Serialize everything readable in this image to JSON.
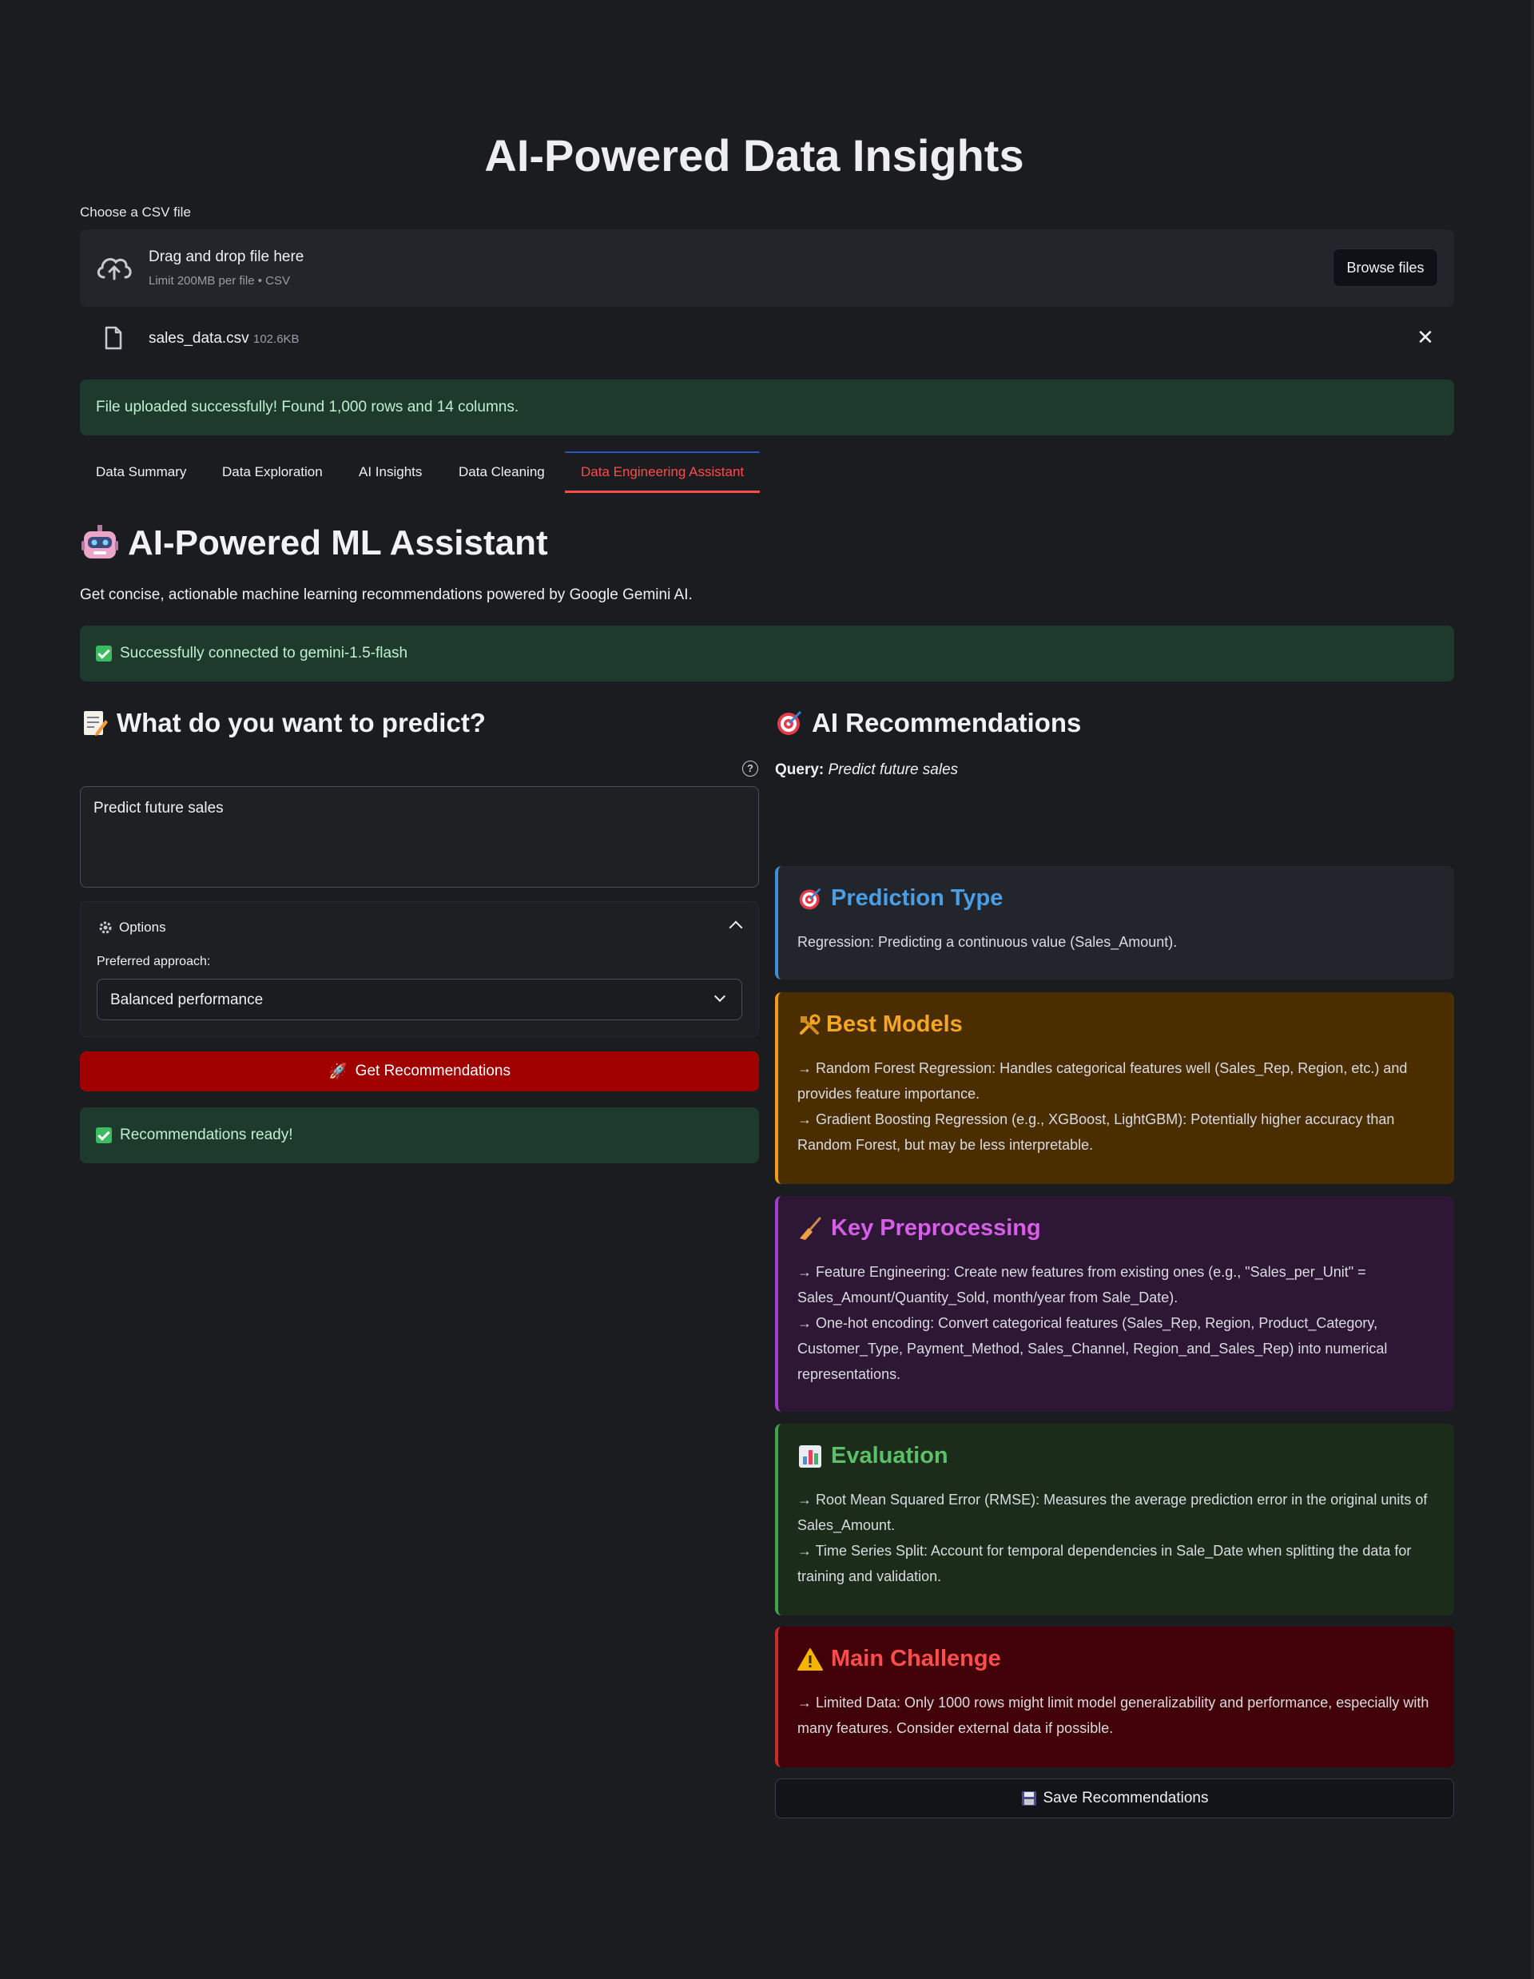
{
  "app": {
    "title": "AI-Powered Data Insights"
  },
  "uploader": {
    "label": "Choose a CSV file",
    "drop_text": "Drag and drop file here",
    "limit_text": "Limit 200MB per file • CSV",
    "browse_label": "Browse files",
    "file_name": "sales_data.csv",
    "file_size": "102.6KB"
  },
  "upload_success": "File uploaded successfully! Found 1,000 rows and 14 columns.",
  "tabs": [
    {
      "label": "Data Summary",
      "active": false
    },
    {
      "label": "Data Exploration",
      "active": false
    },
    {
      "label": "AI Insights",
      "active": false
    },
    {
      "label": "Data Cleaning",
      "active": false
    },
    {
      "label": "Data Engineering Assistant",
      "active": true
    }
  ],
  "assistant": {
    "title": "AI-Powered ML Assistant",
    "description": "Get concise, actionable machine learning recommendations powered by Google Gemini AI.",
    "connected": "Successfully connected to gemini-1.5-flash"
  },
  "predict": {
    "heading": "What do you want to predict?",
    "input_value": "Predict future sales",
    "options_label": "Options",
    "approach_label": "Preferred approach:",
    "approach_value": "Balanced performance",
    "button_label": "Get Recommendations",
    "ready": "Recommendations ready!"
  },
  "recommendations": {
    "heading": "AI Recommendations",
    "query_label": "Query:",
    "query_value": "Predict future sales",
    "prediction_type": {
      "title": "Prediction Type",
      "body": "Regression: Predicting a continuous value (Sales_Amount)."
    },
    "best_models": {
      "title": "Best Models",
      "line1": "→ Random Forest Regression: Handles categorical features well (Sales_Rep, Region, etc.) and provides feature importance.",
      "line2": "→ Gradient Boosting Regression (e.g., XGBoost, LightGBM): Potentially higher accuracy than Random Forest, but may be less interpretable."
    },
    "preprocessing": {
      "title": "Key Preprocessing",
      "line1": "→ Feature Engineering: Create new features from existing ones (e.g., \"Sales_per_Unit\" = Sales_Amount/Quantity_Sold, month/year from Sale_Date).",
      "line2": "→ One-hot encoding: Convert categorical features (Sales_Rep, Region, Product_Category, Customer_Type, Payment_Method, Sales_Channel, Region_and_Sales_Rep) into numerical representations."
    },
    "evaluation": {
      "title": "Evaluation",
      "line1": "→ Root Mean Squared Error (RMSE): Measures the average prediction error in the original units of Sales_Amount.",
      "line2": "→ Time Series Split: Account for temporal dependencies in Sale_Date when splitting the data for training and validation."
    },
    "challenge": {
      "title": "Main Challenge",
      "line1": "→ Limited Data: Only 1000 rows might limit model generalizability and performance, especially with many features. Consider external data if possible."
    },
    "save_label": "Save Recommendations"
  },
  "icons": {
    "upload": "cloud-upload-icon",
    "file": "file-icon",
    "close": "close-icon",
    "check": "check-icon",
    "robot": "robot-icon",
    "memo": "memo-icon",
    "target": "target-icon",
    "tools": "tools-icon",
    "broom": "broom-icon",
    "chart": "bar-chart-icon",
    "warning": "warning-icon",
    "rocket": "rocket-icon",
    "gear": "gear-icon",
    "floppy": "floppy-disk-icon",
    "help": "help-icon"
  },
  "colors": {
    "accent_red": "#ff4b4b",
    "primary_button": "#a10000",
    "success_bg": "#1d3a2c",
    "prediction_title": "#4a9ee6",
    "models_title": "#f5a623",
    "preprocessing_title": "#d65ee8",
    "evaluation_title": "#5cc06a",
    "challenge_title": "#ff4d4d"
  }
}
